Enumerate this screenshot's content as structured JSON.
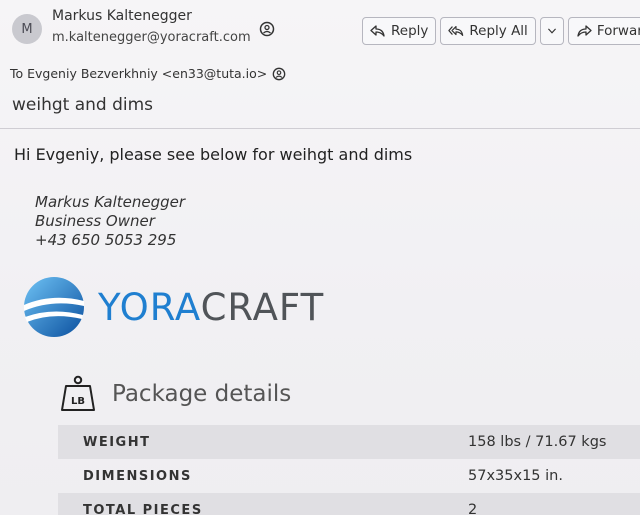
{
  "header": {
    "avatar_initial": "M",
    "sender_name": "Markus Kaltenegger",
    "sender_email": "m.kaltenegger@yoracraft.com",
    "to_line": "To Evgeniy Bezverkhniy <en33@tuta.io>",
    "subject": "weihgt and dims"
  },
  "actions": {
    "reply_label": "Reply",
    "reply_all_label": "Reply All",
    "forward_label": "Forward"
  },
  "body": {
    "greeting": "Hi Evgeniy, please see below for weihgt and dims",
    "signature": {
      "name": "Markus Kaltenegger",
      "title": "Business Owner",
      "phone": "+43 650 5053 295"
    },
    "logo": {
      "part1": "YORA",
      "part2": "CRAFT",
      "color_part1": "#1f7fd0",
      "color_part2": "#505458"
    },
    "package": {
      "icon_label": "LB",
      "title": "Package details",
      "rows": [
        {
          "label": "WEIGHT",
          "value": "158 lbs / 71.67 kgs"
        },
        {
          "label": "DIMENSIONS",
          "value": "57x35x15 in."
        },
        {
          "label": "TOTAL PIECES",
          "value": "2"
        }
      ]
    }
  }
}
